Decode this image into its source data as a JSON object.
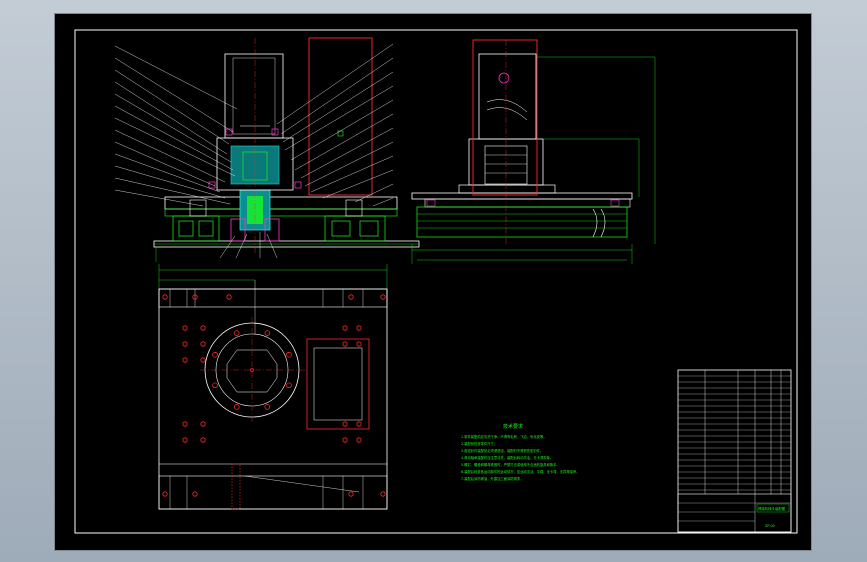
{
  "colors": {
    "background": "#b4bfc9",
    "sheet": "#000000",
    "outline": "#ffffff",
    "part_lines": "#19ff19",
    "red_lines": "#ff2a2a",
    "hatch": "#1ee6e6",
    "hatch_magenta": "#ff33cc"
  },
  "technical_notes": {
    "title": "技术要求",
    "lines": [
      "1.零件装配前应清洗干净，不得有毛刺、飞边、氧化皮等。",
      "2.装配前检查零件尺寸。",
      "3.各密封件装配前必须浸透油，装配时不得损伤密封件。",
      "4.滚动轴承装配时应注意清洗，装配后转动灵活，无卡滞现象。",
      "5.螺钉、螺栓和螺母紧固时，严禁打击或使用不合适的旋具和扳手。",
      "6.装配后检查各运动部件的运动情况，应运动灵活、平稳、无卡滞、无异常噪声。",
      "7.装配后涂防锈油，外露加工面涂防锈漆。"
    ]
  },
  "title_block": {
    "drawing_title": "焊接机械手装配图",
    "drawing_number": "ZP-00"
  },
  "icons": {
    "leader_balloon": "part-number-leader"
  }
}
